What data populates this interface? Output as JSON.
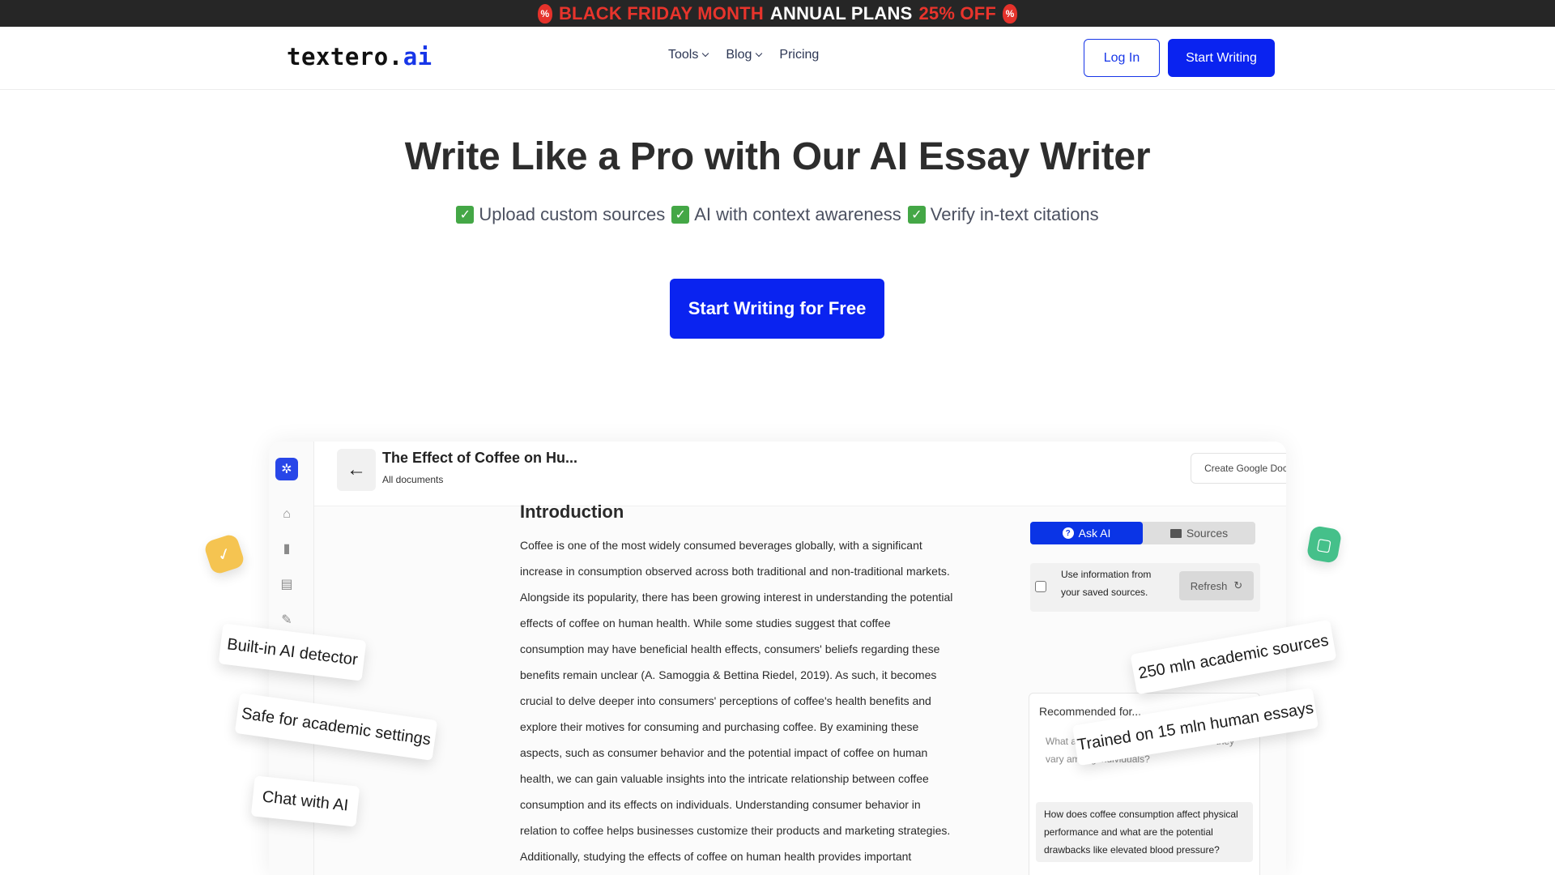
{
  "promo": {
    "part1": "BLACK FRIDAY MONTH",
    "part2": "ANNUAL PLANS",
    "part3": "25% OFF"
  },
  "header": {
    "logo_main": "textero.",
    "logo_ai": "ai",
    "nav": [
      "Tools",
      "Blog",
      "Pricing"
    ],
    "login_label": "Log In",
    "start_label": "Start Writing"
  },
  "hero": {
    "title": "Write Like a Pro with Our AI Essay Writer",
    "features": [
      "Upload custom sources",
      "AI with context awareness",
      "Verify in-text citations"
    ],
    "cta_label": "Start Writing for Free"
  },
  "mockup": {
    "doc_title": "The Effect of Coffee on Hu...",
    "doc_subtitle": "All documents",
    "create_gdoc_label": "Create Google Doc",
    "editor_heading": "Introduction",
    "editor_lines": [
      "Coffee is one of the most widely consumed beverages globally, with a significant",
      "increase in consumption observed across both traditional and non-traditional markets.",
      "Alongside its popularity, there has been growing interest in understanding the potential",
      "effects of coffee on human health. While some studies suggest that coffee",
      "consumption may have beneficial health effects, consumers' beliefs regarding these",
      "benefits remain unclear (A. Samoggia & Bettina Riedel, 2019). As such, it becomes",
      "crucial to delve deeper into consumers' perceptions of coffee's health benefits and",
      "explore their motives for consuming and purchasing coffee. By examining these",
      "aspects, such as consumer behavior and the potential impact of coffee on human",
      "health, we can gain valuable insights into the intricate relationship between coffee",
      "consumption and its effects on individuals. Understanding consumer behavior in",
      "relation to coffee helps businesses customize their products and marketing strategies.",
      "Additionally, studying the effects of coffee on human health provides important"
    ],
    "tab_ask": "Ask AI",
    "tab_sources": "Sources",
    "saved_text": "Use information from your saved sources.",
    "refresh_label": "Refresh",
    "rec_title": "Recommended for...",
    "rec_q1": "What a... caffeine in coffee and how do they vary among individuals?",
    "rec_q2": "How does coffee consumption affect physical performance and what are the potential drawbacks like elevated blood pressure?"
  },
  "chips": {
    "ai_detector": "Built-in AI detector",
    "academic": "Safe for academic settings",
    "chat": "Chat with AI",
    "sources": "250 mln academic sources",
    "trained": "Trained on 15 mln human essays"
  },
  "colors": {
    "primary": "#0a23f0",
    "promo_red": "#e8342c",
    "check_green": "#44a746",
    "yellow_badge": "#f5c451",
    "green_badge": "#45c08a"
  },
  "icons": {
    "flame": "flame-icon",
    "check": "check-icon",
    "back": "arrow-left-icon",
    "home": "home-icon",
    "bookmark": "bookmark-icon",
    "sources": "sources-icon",
    "edit": "pencil-icon",
    "refresh": "refresh-icon",
    "chat": "chat-icon"
  }
}
